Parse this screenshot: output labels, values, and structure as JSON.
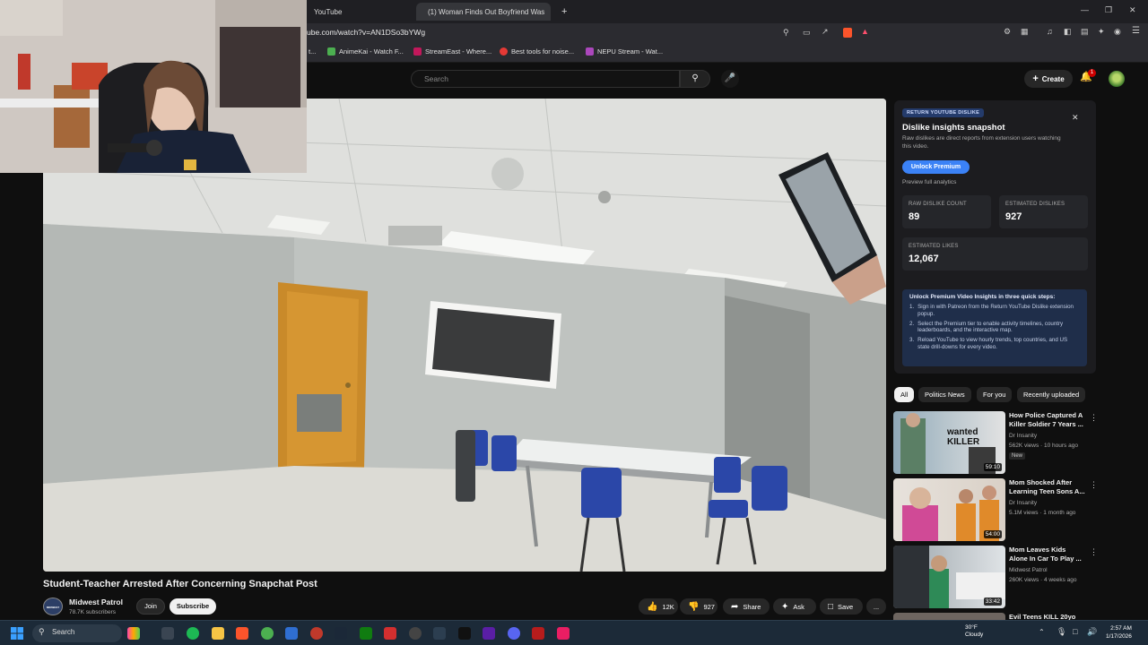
{
  "browser": {
    "tabs": [
      {
        "label": "YouTube"
      },
      {
        "label": "(1) Woman Finds Out Boyfriend Was"
      }
    ],
    "new_tab": "+",
    "url": "ube.com/watch?v=AN1DSo3bYWg",
    "bookmarks": [
      {
        "label": "t..."
      },
      {
        "label": "AnimeKai - Watch F..."
      },
      {
        "label": "StreamEast - Where..."
      },
      {
        "label": "Best tools for noise..."
      },
      {
        "label": "NEPU Stream - Wat..."
      }
    ]
  },
  "header": {
    "search_placeholder": "Search",
    "create_label": "Create",
    "notification_count": "1"
  },
  "video": {
    "title": "Student-Teacher Arrested After Concerning Snapchat Post",
    "channel": "Midwest Patrol",
    "channel_logo_text": "MIDWEST PATROL",
    "subscribers": "78.7K subscribers",
    "join_label": "Join",
    "subscribe_label": "Subscribe",
    "likes": "12K",
    "dislikes": "927",
    "share_label": "Share",
    "ask_label": "Ask",
    "save_label": "Save",
    "more_label": "..."
  },
  "ryd_panel": {
    "badge": "RETURN YOUTUBE DISLIKE",
    "title": "Dislike insights snapshot",
    "description": "Raw dislikes are direct reports from extension users watching this video.",
    "unlock_label": "Unlock Premium",
    "preview_label": "Preview full analytics",
    "stats": [
      {
        "label": "RAW DISLIKE COUNT",
        "value": "89"
      },
      {
        "label": "ESTIMATED DISLIKES",
        "value": "927"
      },
      {
        "label": "ESTIMATED LIKES",
        "value": "12,067"
      }
    ],
    "steps_title": "Unlock Premium Video Insights in three quick steps:",
    "steps": [
      {
        "n": "1.",
        "text": "Sign in with Patreon from the Return YouTube Dislike extension popup."
      },
      {
        "n": "2.",
        "text": "Select the Premium tier to enable activity timelines, country leaderboards, and the interactive map."
      },
      {
        "n": "3.",
        "text": "Reload YouTube to view hourly trends, top countries, and US state drill-downs for every video."
      }
    ]
  },
  "filters": [
    {
      "label": "All"
    },
    {
      "label": "Politics News"
    },
    {
      "label": "For you"
    },
    {
      "label": "Recently uploaded"
    }
  ],
  "recommendations": [
    {
      "title": "How Police Captured A Killer Soldier 7 Years ...",
      "channel": "Dr Insanity",
      "meta": "562K views · 10 hours ago",
      "badge": "New",
      "duration": "59:10",
      "thumb_text": "wanted KILLER"
    },
    {
      "title": "Mom Shocked After Learning Teen Sons A...",
      "channel": "Dr Insanity",
      "meta": "5.1M views · 1 month ago",
      "badge": "",
      "duration": "54:00",
      "thumb_text": ""
    },
    {
      "title": "Mom Leaves Kids Alone In Car To Play ...",
      "channel": "Midwest Patrol",
      "meta": "260K views · 4 weeks ago",
      "badge": "",
      "duration": "33:42",
      "thumb_text": ""
    },
    {
      "title": "Evil Teens KILL 20yo",
      "channel": "",
      "meta": "",
      "badge": "",
      "duration": "",
      "thumb_text": ""
    }
  ],
  "taskbar": {
    "search_label": "Search",
    "weather_temp": "30°F",
    "weather_desc": "Cloudy",
    "time": "2:57 AM",
    "date": "1/17/2026"
  },
  "colors": {
    "accent_blue": "#3b82f6",
    "youtube_red": "#ff0000",
    "background": "#0f0f0f"
  }
}
